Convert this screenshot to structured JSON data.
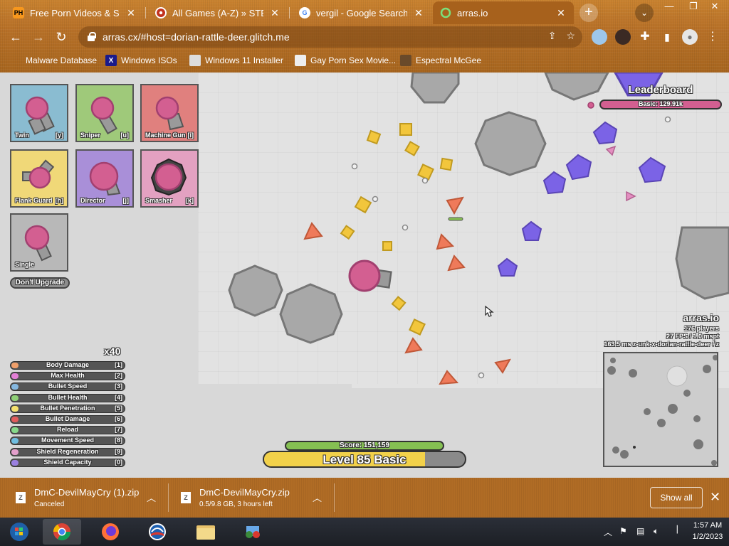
{
  "browser": {
    "tabs": [
      {
        "title": "Free Porn Videos & Sex M",
        "favicon": "PH"
      },
      {
        "title": "All Games (A-Z) » STEAM",
        "favicon": "steam"
      },
      {
        "title": "vergil - Google Search",
        "favicon": "G"
      },
      {
        "title": "arras.io",
        "favicon": "arras"
      }
    ],
    "address": "arras.cx/#host=dorian-rattle-deer.glitch.me",
    "bookmarks": [
      {
        "label": "Malware Database"
      },
      {
        "label": "Windows ISOs"
      },
      {
        "label": "Windows 11 Installer"
      },
      {
        "label": "Gay Porn Sex Movie..."
      },
      {
        "label": "Espectral McGee"
      }
    ]
  },
  "game": {
    "upgrades": [
      {
        "name": "Twin",
        "key": "[y]",
        "color": "#8abcd1"
      },
      {
        "name": "Sniper",
        "key": "[u]",
        "color": "#9fc97a"
      },
      {
        "name": "Machine Gun",
        "key": "[i]",
        "color": "#e0807e"
      },
      {
        "name": "Flank Guard",
        "key": "[h]",
        "color": "#f0d878"
      },
      {
        "name": "Director",
        "key": "[j]",
        "color": "#a98fd8"
      },
      {
        "name": "Smasher",
        "key": "[k]",
        "color": "#e3a1c1"
      },
      {
        "name": "Single",
        "key": "",
        "color": "#b8b8b8"
      }
    ],
    "dont_upgrade": "Don't Upgrade",
    "skill_points": "x40",
    "stats": [
      {
        "label": "Body Damage",
        "key": "[1]",
        "color": "#f0a06b"
      },
      {
        "label": "Max Health",
        "key": "[2]",
        "color": "#e37fd5"
      },
      {
        "label": "Bullet Speed",
        "key": "[3]",
        "color": "#85b8e0"
      },
      {
        "label": "Bullet Health",
        "key": "[4]",
        "color": "#8fd077"
      },
      {
        "label": "Bullet Penetration",
        "key": "[5]",
        "color": "#f5e26e"
      },
      {
        "label": "Bullet Damage",
        "key": "[6]",
        "color": "#e05c5c"
      },
      {
        "label": "Reload",
        "key": "[7]",
        "color": "#86d98a"
      },
      {
        "label": "Movement Speed",
        "key": "[8]",
        "color": "#6fbde0"
      },
      {
        "label": "Shield Regeneration",
        "key": "[9]",
        "color": "#e39fcb"
      },
      {
        "label": "Shield Capacity",
        "key": "[0]",
        "color": "#9a80e0"
      }
    ],
    "score": "Score: 151,159",
    "score_progress": 1.0,
    "level": "Level 85 Basic",
    "level_progress": 0.8,
    "leaderboard": {
      "title": "Leaderboard",
      "entries": [
        {
          "text": "Basic: 129.91k"
        }
      ]
    },
    "server": {
      "name": "arras.io",
      "players": "176 players",
      "fps": "27 FPS / 1.0 mspt",
      "info": "163.5 ms  z-unk-x-dorian-rattle-deer #z"
    },
    "colors": {
      "player": "#d35f91",
      "square": "#f2c63c",
      "triangle": "#ef7a5a",
      "pentagon": "#7b63e6",
      "rock": "#a8a8a8",
      "barrel": "#9a9a9a"
    }
  },
  "downloads": {
    "items": [
      {
        "name": "DmC-DevilMayCry (1).zip",
        "status": "Canceled"
      },
      {
        "name": "DmC-DevilMayCry.zip",
        "status": "0.5/9.8 GB, 3 hours left"
      }
    ],
    "show_all": "Show all"
  },
  "taskbar": {
    "time": "1:57 AM",
    "date": "1/2/2023"
  }
}
